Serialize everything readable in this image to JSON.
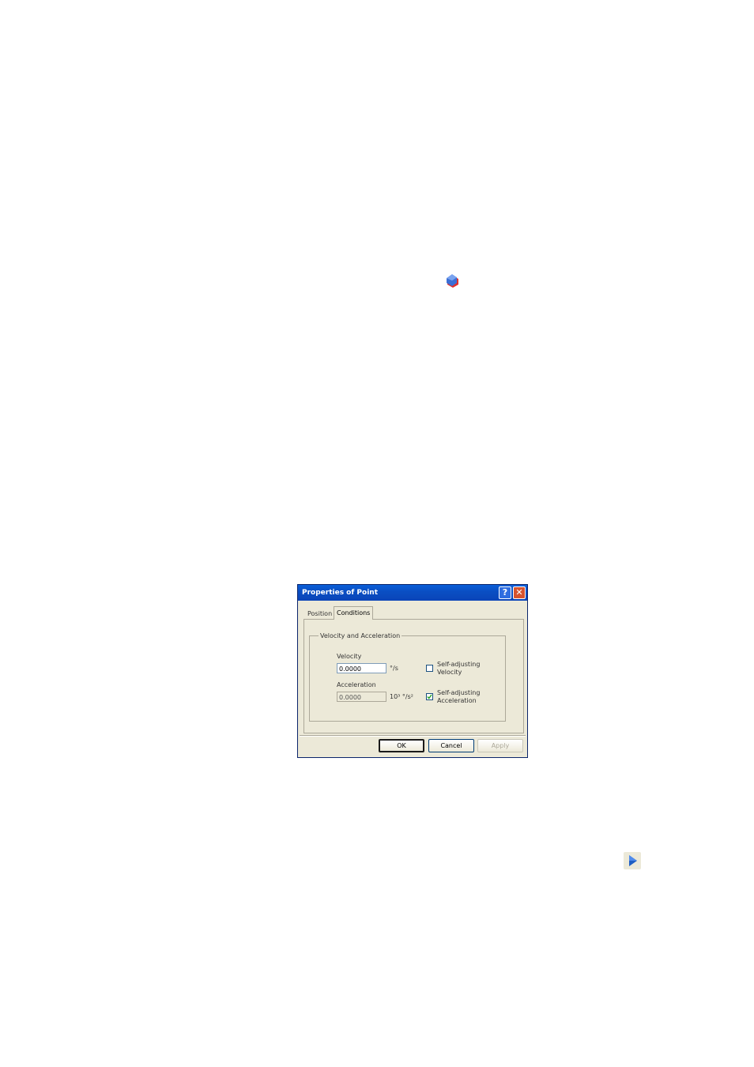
{
  "icons": {
    "top_icon": "shape-selection-icon",
    "bottom_icon": "play-arrow-icon"
  },
  "dialog": {
    "title": "Properties of Point",
    "help_label": "?",
    "close_label": "✕",
    "tabs": [
      {
        "label": "Position"
      },
      {
        "label": "Conditions"
      }
    ],
    "active_tab": "Conditions",
    "group_title": "Velocity and Acceleration",
    "velocity": {
      "label": "Velocity",
      "value": "0.0000",
      "unit": "°/s",
      "self_adjust_label_1": "Self-adjusting",
      "self_adjust_label_2": "Velocity",
      "self_adjust_checked": false
    },
    "acceleration": {
      "label": "Acceleration",
      "value": "0.0000",
      "unit": "10³ °/s²",
      "self_adjust_label_1": "Self-adjusting",
      "self_adjust_label_2": "Acceleration",
      "self_adjust_checked": true
    },
    "buttons": {
      "ok": "OK",
      "cancel": "Cancel",
      "apply": "Apply"
    }
  },
  "colors": {
    "titlebar": "#0a4fc4",
    "dialog_bg": "#ece9d8",
    "close_button": "#d8542f"
  }
}
